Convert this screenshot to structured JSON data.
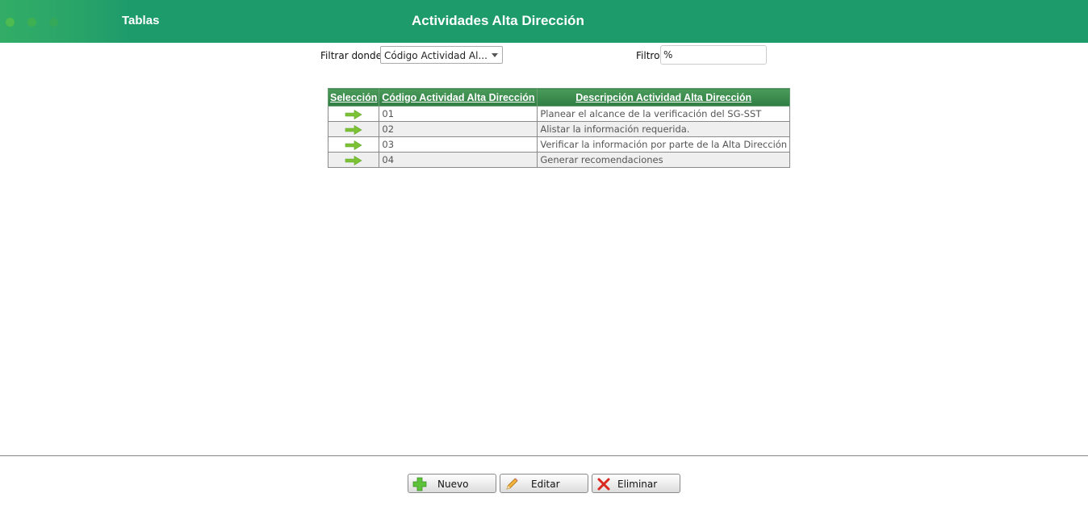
{
  "header": {
    "left_title": "Tablas",
    "title": "Actividades Alta Dirección",
    "dot_colors": [
      "#4dbb4f",
      "#3fb052",
      "#35a85a"
    ]
  },
  "filter": {
    "where_label": "Filtrar donde",
    "where_selected": "Código Actividad Al...",
    "filter_label": "Filtro",
    "filter_value": "%"
  },
  "table": {
    "columns": [
      "Selección",
      "Código Actividad Alta Dirección",
      "Descripción Actividad Alta Dirección"
    ],
    "rows": [
      {
        "code": "01",
        "description": "Planear el alcance de la verificación del SG-SST"
      },
      {
        "code": "02",
        "description": "Alistar la información requerida."
      },
      {
        "code": "03",
        "description": "Verificar la información por parte de la Alta Dirección"
      },
      {
        "code": "04",
        "description": "Generar recomendaciones"
      }
    ],
    "select_icon": "arrow-right-icon"
  },
  "buttons": {
    "new_label": "Nuevo",
    "edit_label": "Editar",
    "delete_label": "Eliminar"
  },
  "colors": {
    "header_bg": "#1e9b6b",
    "table_header": "#3a8a4c",
    "arrow": "#7cc234"
  }
}
